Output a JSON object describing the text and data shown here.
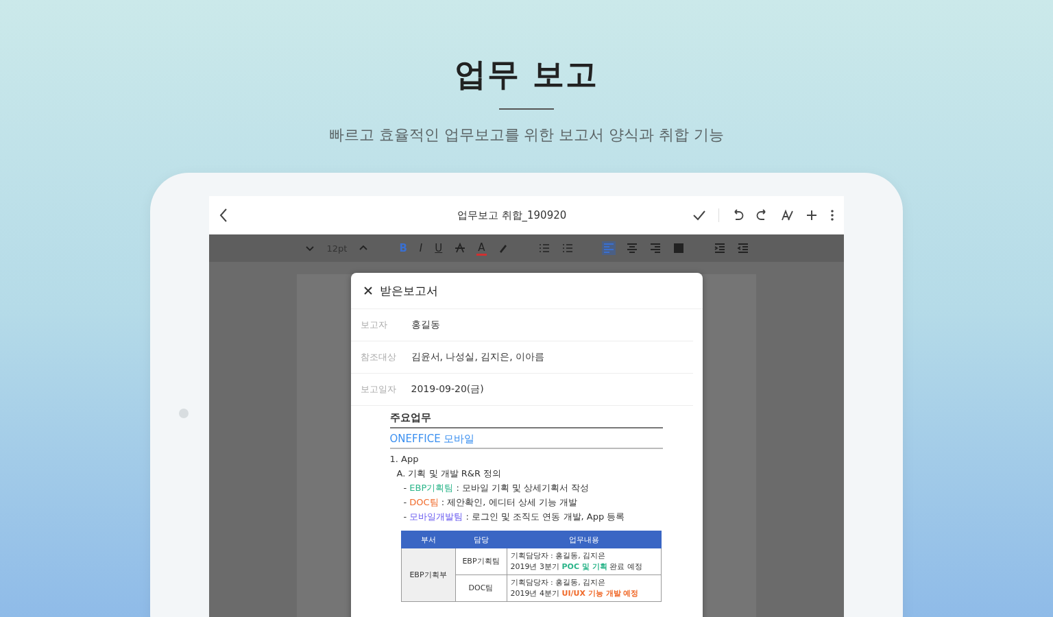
{
  "hero": {
    "title": "업무 보고",
    "subtitle": "빠르고 효율적인 업무보고를 위한 보고서 양식과 취합 기능"
  },
  "app_bar": {
    "title": "업무보고 취합_190920"
  },
  "toolbar": [
    {
      "kind": "step-down",
      "selected": false
    },
    {
      "kind": "size",
      "label": "12pt",
      "selected": false
    },
    {
      "kind": "step-up",
      "selected": false
    },
    {
      "kind": "bold",
      "label": "B",
      "selected": true
    },
    {
      "kind": "italic",
      "label": "I",
      "selected": false
    },
    {
      "kind": "underline",
      "label": "U",
      "selected": false
    },
    {
      "kind": "strike",
      "selected": false
    },
    {
      "kind": "font-color",
      "label": "A",
      "selected": false
    },
    {
      "kind": "highlight",
      "selected": false
    },
    {
      "kind": "bullets",
      "selected": false
    },
    {
      "kind": "numbers",
      "selected": false
    },
    {
      "kind": "align-left",
      "selected": true
    },
    {
      "kind": "align-center",
      "selected": false
    },
    {
      "kind": "align-right",
      "selected": false
    },
    {
      "kind": "justify",
      "selected": false
    },
    {
      "kind": "indent",
      "selected": false
    },
    {
      "kind": "outdent",
      "selected": false
    }
  ],
  "dialog": {
    "title": "받은보고서",
    "fields": [
      {
        "label": "보고자",
        "value": "홍길동"
      },
      {
        "label": "참조대상",
        "value": "김윤서, 나성실, 김지은, 이아름"
      },
      {
        "label": "보고일자",
        "value": "2019-09-20(금)"
      }
    ],
    "document": {
      "heading": "주요업무",
      "section": "ONEFFICE 모바일",
      "item": "1. App",
      "subitem": "A. 기획 및 개발 R&R 정의",
      "lines": [
        {
          "bullet": "-",
          "team": "EBP기획팀",
          "color": "#2bb58a",
          "text": " : 모바일 기획 및 상세기획서 작성"
        },
        {
          "bullet": "-",
          "team": "DOC팀",
          "color": "#f06a2a",
          "text": " : 제안확인, 에디터 상세 기능 개발"
        },
        {
          "bullet": "-",
          "team": "모바일개발팀",
          "color": "#6a5cf0",
          "text": " : 로그인 및 조직도 연동 개발, App 등록"
        }
      ],
      "table": {
        "columns": [
          "부서",
          "담당",
          "업무내용"
        ],
        "rows": [
          {
            "dept": "EBP기획부",
            "team": "EBP기획팀",
            "lines": [
              {
                "text": "기획담당자 : 홍길동, 김지은"
              },
              {
                "text": "2019년 3분기 ",
                "highlight": "POC 및 기획",
                "color": "#2bb58a",
                "rest": " 완료 예정"
              }
            ]
          },
          {
            "team": "DOC팀",
            "lines": [
              {
                "text": "기획담당자 : 홍길동, 김지은"
              },
              {
                "text": "2019년 4분기 ",
                "highlight": "UI/UX 기능 개발 예정",
                "color": "#f06a2a"
              }
            ]
          }
        ]
      }
    }
  }
}
